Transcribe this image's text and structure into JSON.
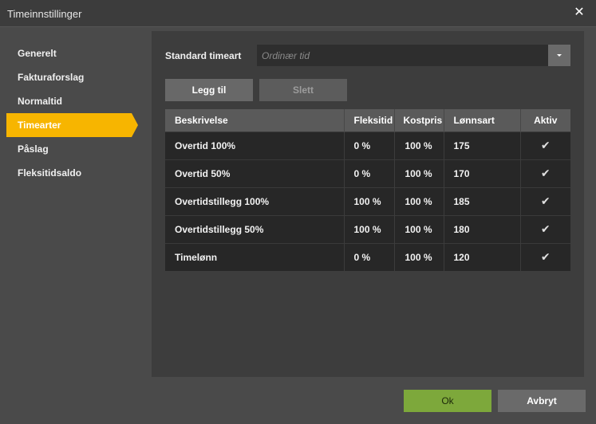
{
  "window": {
    "title": "Timeinnstillinger",
    "close_glyph": "✕"
  },
  "sidebar": {
    "items": [
      {
        "label": "Generelt"
      },
      {
        "label": "Fakturaforslag"
      },
      {
        "label": "Normaltid"
      },
      {
        "label": "Timearter",
        "active": true
      },
      {
        "label": "Påslag"
      },
      {
        "label": "Fleksitidsaldo"
      }
    ]
  },
  "main": {
    "standard_label": "Standard timeart",
    "standard_placeholder": "Ordinær tid",
    "add_label": "Legg til",
    "delete_label": "Slett",
    "columns": [
      "Beskrivelse",
      "Fleksitid",
      "Kostpris",
      "Lønnsart",
      "Aktiv"
    ],
    "rows": [
      {
        "description": "Overtid 100%",
        "flex": "0 %",
        "cost": "100 %",
        "wage": "175",
        "active": "✔"
      },
      {
        "description": "Overtid 50%",
        "flex": "0 %",
        "cost": "100 %",
        "wage": "170",
        "active": "✔"
      },
      {
        "description": "Overtidstillegg 100%",
        "flex": "100 %",
        "cost": "100 %",
        "wage": "185",
        "active": "✔"
      },
      {
        "description": "Overtidstillegg 50%",
        "flex": "100 %",
        "cost": "100 %",
        "wage": "180",
        "active": "✔"
      },
      {
        "description": "Timelønn",
        "flex": "0 %",
        "cost": "100 %",
        "wage": "120",
        "active": "✔"
      }
    ]
  },
  "footer": {
    "ok_label": "Ok",
    "cancel_label": "Avbryt"
  },
  "colors": {
    "accent": "#f7b500",
    "ok": "#7da83b"
  }
}
